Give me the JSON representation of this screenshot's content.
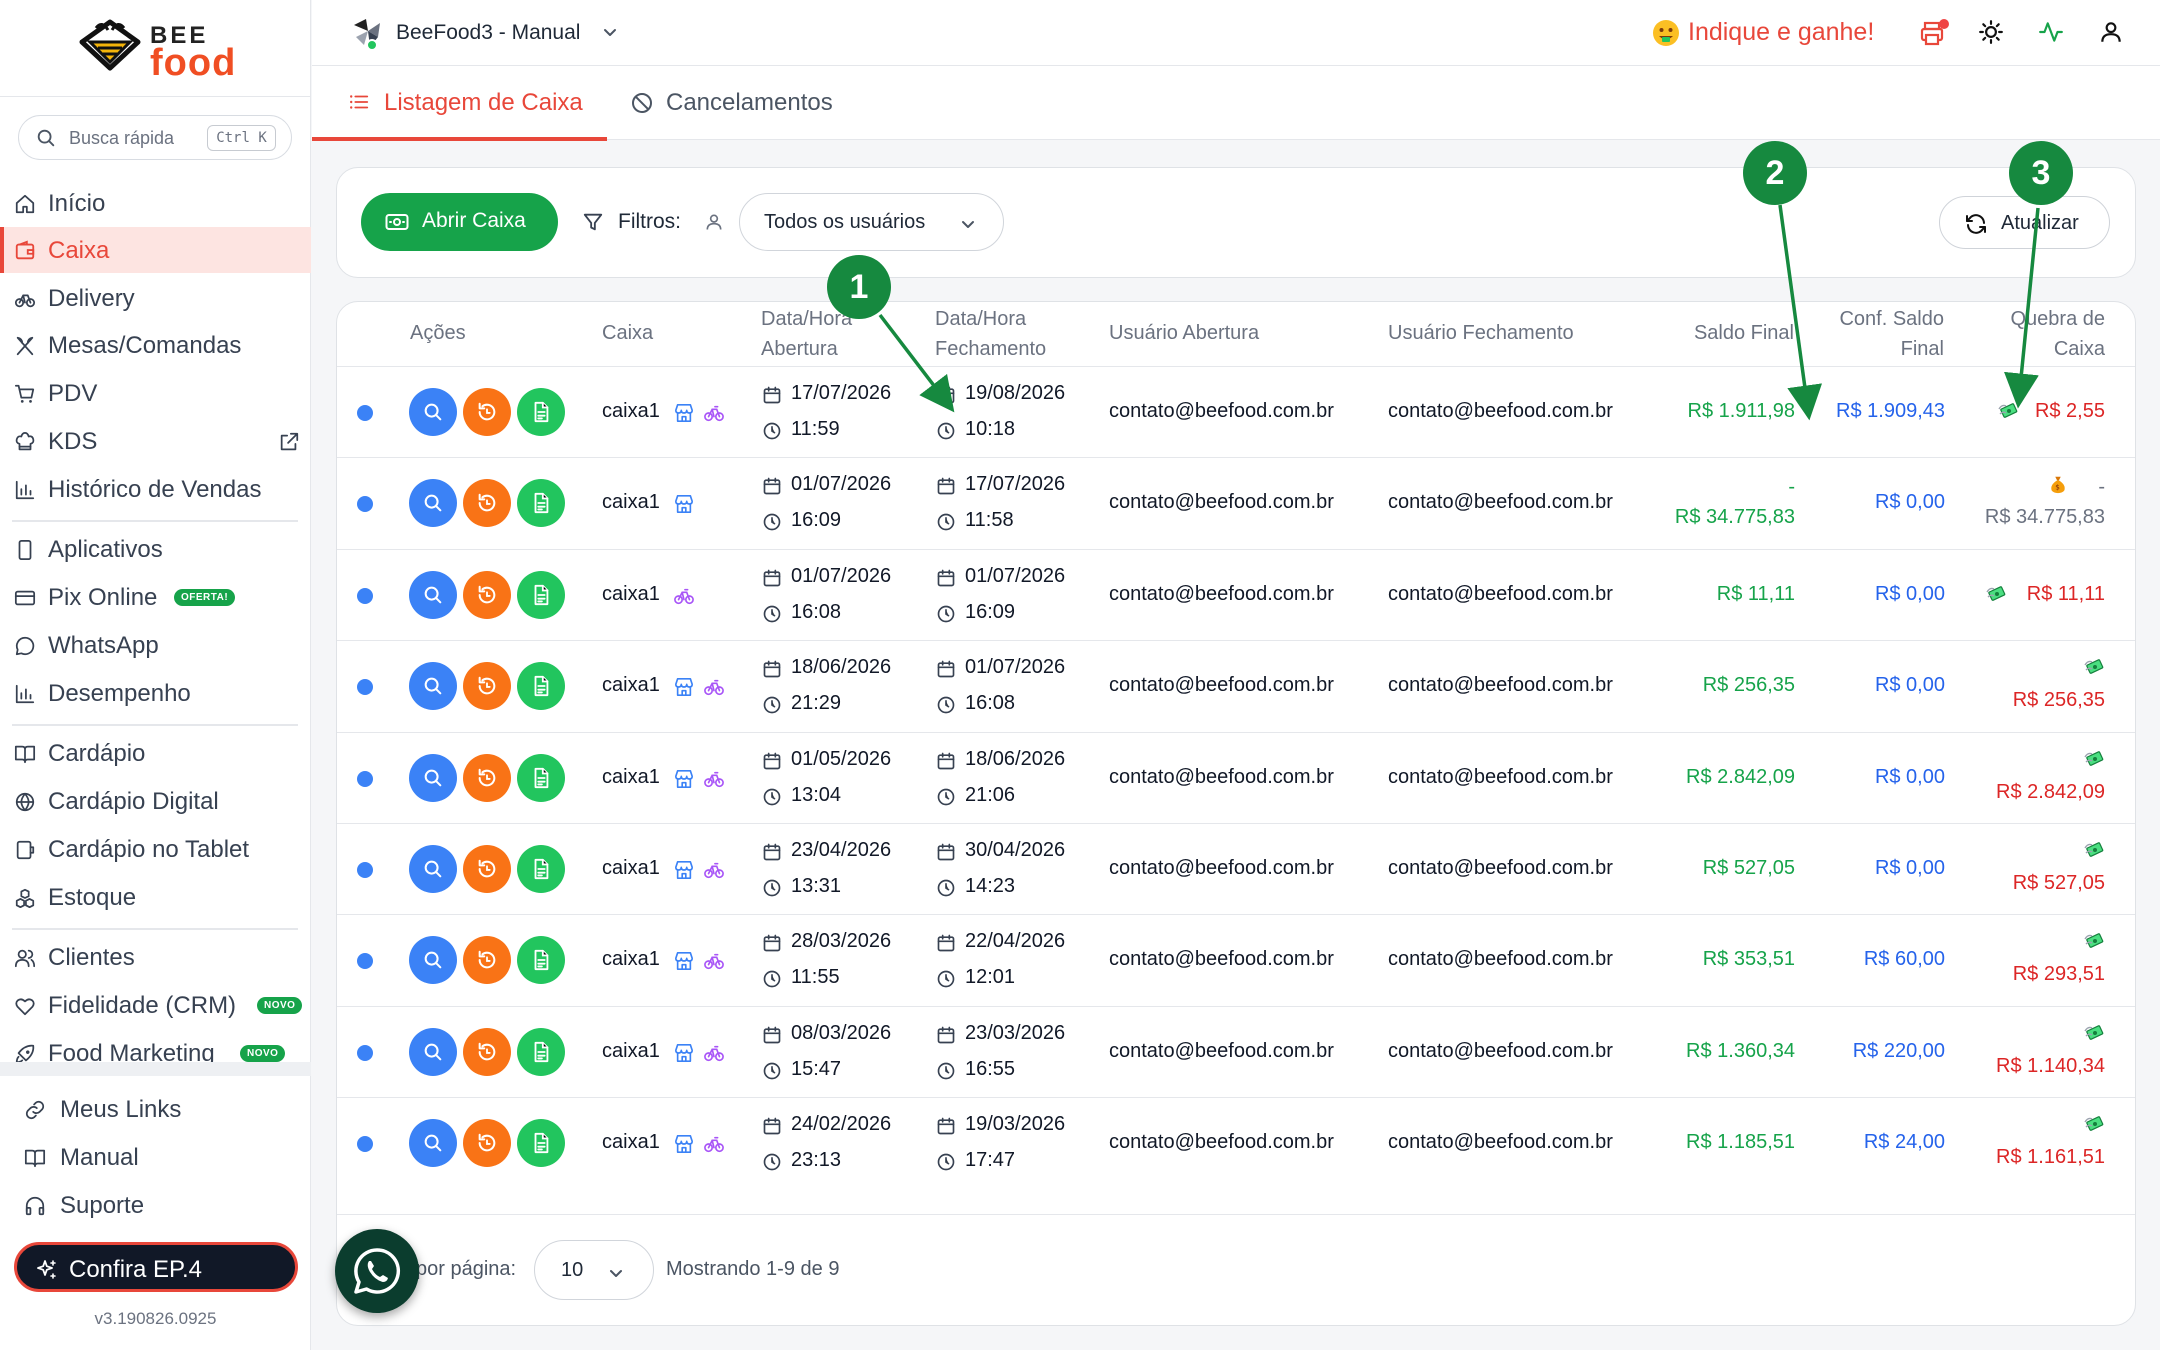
{
  "sidebar": {
    "logo_top": "BEE",
    "logo_bottom": "food",
    "search_placeholder": "Busca rápida",
    "search_shortcut": "Ctrl K",
    "items": [
      {
        "label": "Início",
        "icon": "home-icon"
      },
      {
        "label": "Caixa",
        "icon": "wallet-icon",
        "active": true
      },
      {
        "label": "Delivery",
        "icon": "bike-icon"
      },
      {
        "label": "Mesas/Comandas",
        "icon": "utensils-icon"
      },
      {
        "label": "PDV",
        "icon": "cart-icon"
      },
      {
        "label": "KDS",
        "icon": "chef-hat-icon"
      },
      {
        "label": "Histórico de Vendas",
        "icon": "bar-chart-icon"
      },
      {
        "label": "Aplicativos",
        "icon": "smartphone-icon"
      },
      {
        "label": "Pix Online",
        "icon": "card-icon",
        "badge": "OFERTA!"
      },
      {
        "label": "WhatsApp",
        "icon": "chat-icon"
      },
      {
        "label": "Desempenho",
        "icon": "bar-chart-icon"
      },
      {
        "label": "Cardápio",
        "icon": "book-icon"
      },
      {
        "label": "Cardápio Digital",
        "icon": "globe-icon"
      },
      {
        "label": "Cardápio no Tablet",
        "icon": "tablet-icon"
      },
      {
        "label": "Estoque",
        "icon": "boxes-icon"
      },
      {
        "label": "Clientes",
        "icon": "users-icon"
      },
      {
        "label": "Fidelidade (CRM)",
        "icon": "heart-icon",
        "badge": "NOVO"
      },
      {
        "label": "Food Marketing",
        "icon": "rocket-icon",
        "badge": "NOVO"
      }
    ],
    "bottom_items": [
      {
        "label": "Meus Links",
        "icon": "link-icon"
      },
      {
        "label": "Manual",
        "icon": "book-open-icon"
      },
      {
        "label": "Suporte",
        "icon": "headphones-icon"
      }
    ],
    "confira_label": "Confira EP.4",
    "version": "v3.190826.0925"
  },
  "header": {
    "store_name": "BeeFood3 - Manual",
    "indique": "Indique e ganhe!"
  },
  "tabs": [
    {
      "label": "Listagem de Caixa",
      "active": true
    },
    {
      "label": "Cancelamentos",
      "active": false
    }
  ],
  "filters": {
    "abrir_caixa": "Abrir Caixa",
    "filtros_label": "Filtros:",
    "users_select": "Todos os usuários",
    "atualizar": "Atualizar"
  },
  "table": {
    "headers": {
      "acoes": "Ações",
      "caixa": "Caixa",
      "abertura_1": "Data/Hora",
      "abertura_2": "Abertura",
      "fechamento_1": "Data/Hora",
      "fechamento_2": "Fechamento",
      "usuario_abertura": "Usuário Abertura",
      "usuario_fechamento": "Usuário Fechamento",
      "saldo_final": "Saldo Final",
      "conf_1": "Conf. Saldo",
      "conf_2": "Final",
      "quebra_1": "Quebra de",
      "quebra_2": "Caixa"
    },
    "rows": [
      {
        "caixa": "caixa1",
        "icons": [
          "store",
          "bike"
        ],
        "open_date": "17/07/2026",
        "open_time": "11:59",
        "close_date": "19/08/2026",
        "close_time": "10:18",
        "user_open": "contato@beefood.com.br",
        "user_close": "contato@beefood.com.br",
        "saldo_prefix": "",
        "saldo": "R$ 1.911,98",
        "conf": "R$ 1.909,43",
        "quebra_emoji": "money-wings",
        "quebra_prefix": "",
        "quebra": "R$ 2,55",
        "quebra_color": "red",
        "quebra_inline": true
      },
      {
        "caixa": "caixa1",
        "icons": [
          "store"
        ],
        "open_date": "01/07/2026",
        "open_time": "16:09",
        "close_date": "17/07/2026",
        "close_time": "11:58",
        "user_open": "contato@beefood.com.br",
        "user_close": "contato@beefood.com.br",
        "saldo_prefix": "-",
        "saldo": "R$ 34.775,83",
        "conf": "R$ 0,00",
        "quebra_emoji": "money-bag",
        "quebra_prefix": "-",
        "quebra": "R$ 34.775,83",
        "quebra_color": "grey",
        "quebra_inline": false
      },
      {
        "caixa": "caixa1",
        "icons": [
          "bike"
        ],
        "open_date": "01/07/2026",
        "open_time": "16:08",
        "close_date": "01/07/2026",
        "close_time": "16:09",
        "user_open": "contato@beefood.com.br",
        "user_close": "contato@beefood.com.br",
        "saldo_prefix": "",
        "saldo": "R$ 11,11",
        "conf": "R$ 0,00",
        "quebra_emoji": "money-wings",
        "quebra_prefix": "",
        "quebra": "R$ 11,11",
        "quebra_color": "red",
        "quebra_inline": true
      },
      {
        "caixa": "caixa1",
        "icons": [
          "store",
          "bike"
        ],
        "open_date": "18/06/2026",
        "open_time": "21:29",
        "close_date": "01/07/2026",
        "close_time": "16:08",
        "user_open": "contato@beefood.com.br",
        "user_close": "contato@beefood.com.br",
        "saldo_prefix": "",
        "saldo": "R$ 256,35",
        "conf": "R$ 0,00",
        "quebra_emoji": "money-wings",
        "quebra_prefix": "",
        "quebra": "R$ 256,35",
        "quebra_color": "red",
        "quebra_inline": false
      },
      {
        "caixa": "caixa1",
        "icons": [
          "store",
          "bike"
        ],
        "open_date": "01/05/2026",
        "open_time": "13:04",
        "close_date": "18/06/2026",
        "close_time": "21:06",
        "user_open": "contato@beefood.com.br",
        "user_close": "contato@beefood.com.br",
        "saldo_prefix": "",
        "saldo": "R$ 2.842,09",
        "conf": "R$ 0,00",
        "quebra_emoji": "money-wings",
        "quebra_prefix": "",
        "quebra": "R$ 2.842,09",
        "quebra_color": "red",
        "quebra_inline": false
      },
      {
        "caixa": "caixa1",
        "icons": [
          "store",
          "bike"
        ],
        "open_date": "23/04/2026",
        "open_time": "13:31",
        "close_date": "30/04/2026",
        "close_time": "14:23",
        "user_open": "contato@beefood.com.br",
        "user_close": "contato@beefood.com.br",
        "saldo_prefix": "",
        "saldo": "R$ 527,05",
        "conf": "R$ 0,00",
        "quebra_emoji": "money-wings",
        "quebra_prefix": "",
        "quebra": "R$ 527,05",
        "quebra_color": "red",
        "quebra_inline": false
      },
      {
        "caixa": "caixa1",
        "icons": [
          "store",
          "bike"
        ],
        "open_date": "28/03/2026",
        "open_time": "11:55",
        "close_date": "22/04/2026",
        "close_time": "12:01",
        "user_open": "contato@beefood.com.br",
        "user_close": "contato@beefood.com.br",
        "saldo_prefix": "",
        "saldo": "R$ 353,51",
        "conf": "R$ 60,00",
        "quebra_emoji": "money-wings",
        "quebra_prefix": "",
        "quebra": "R$ 293,51",
        "quebra_color": "red",
        "quebra_inline": false
      },
      {
        "caixa": "caixa1",
        "icons": [
          "store",
          "bike"
        ],
        "open_date": "08/03/2026",
        "open_time": "15:47",
        "close_date": "23/03/2026",
        "close_time": "16:55",
        "user_open": "contato@beefood.com.br",
        "user_close": "contato@beefood.com.br",
        "saldo_prefix": "",
        "saldo": "R$ 1.360,34",
        "conf": "R$ 220,00",
        "quebra_emoji": "money-wings",
        "quebra_prefix": "",
        "quebra": "R$ 1.140,34",
        "quebra_color": "red",
        "quebra_inline": false
      },
      {
        "caixa": "caixa1",
        "icons": [
          "store",
          "bike"
        ],
        "open_date": "24/02/2026",
        "open_time": "23:13",
        "close_date": "19/03/2026",
        "close_time": "17:47",
        "user_open": "contato@beefood.com.br",
        "user_close": "contato@beefood.com.br",
        "saldo_prefix": "",
        "saldo": "R$ 1.185,51",
        "conf": "R$ 24,00",
        "quebra_emoji": "money-wings",
        "quebra_prefix": "",
        "quebra": "R$ 1.161,51",
        "quebra_color": "red",
        "quebra_inline": false
      }
    ]
  },
  "pagination": {
    "per_page_label": "por página:",
    "per_page": "10",
    "showing": "Mostrando 1-9 de 9"
  },
  "annotations": [
    "1",
    "2",
    "3"
  ],
  "colors": {
    "accent": "#e8473a",
    "primary_green": "#16a34a",
    "annotation_green": "#16893f",
    "blue": "#2563eb",
    "red": "#dc2626"
  }
}
